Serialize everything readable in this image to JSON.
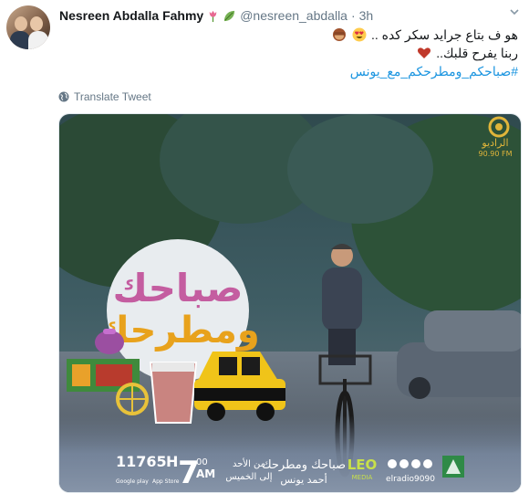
{
  "tweet": {
    "author_name": "Nesreen Abdalla Fahmy",
    "handle": "@nesreen_abdalla",
    "separator": "·",
    "time": "3h",
    "line1": "هو ف بتاع جرايد سكر كده ..",
    "line2": "ربنا يفرح قلبك..",
    "hashtag": "#صباحكم_ومطرحكم_مع_يونس",
    "translate_label": "Translate Tweet"
  },
  "icons": {
    "flower": "tulip-icon",
    "leaf": "leaf-icon",
    "more": "chevron-down-icon",
    "globe": "globe-icon"
  },
  "media": {
    "logo_line1": "الراديو",
    "logo_freq": "90.90 FM",
    "show_title_top": "صباحك",
    "show_title_bottom": "ومطرحك",
    "shortcode": "11765",
    "shortcode_suffix": "H",
    "time_hour": "7",
    "time_minutes": "00",
    "time_ampm": "AM",
    "days_line1": "من الأحد",
    "days_line2": "إلى الخميس",
    "program_name": "صباحك ومطرحك",
    "presenter": "أحمد يونس",
    "leo_label": "LEO",
    "leo_sub": "MEDIA",
    "social_handle": "elradio9090",
    "app_label_1": "Google play",
    "app_label_2": "App Store"
  },
  "colors": {
    "link": "#1b95e0",
    "muted": "#657786",
    "heart": "#c0392b"
  }
}
